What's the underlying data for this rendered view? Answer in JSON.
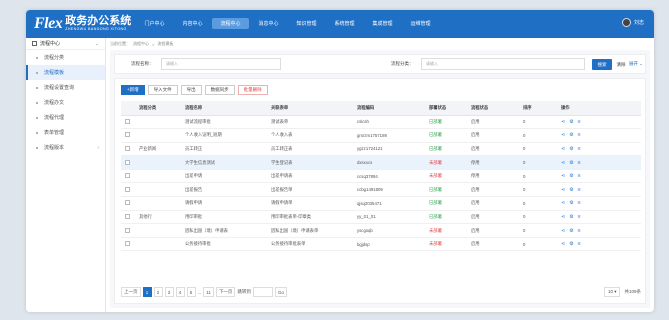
{
  "app": {
    "logo_mark": "Flex",
    "logo_cn": "政务办公系统",
    "logo_en": "ZHENGWU BANGONG XITONG"
  },
  "nav": [
    "门户中心",
    "内容中心",
    "流程中心",
    "消息中心",
    "知识管理",
    "系统管理",
    "集成管理",
    "运维管理"
  ],
  "user": {
    "name": "刘志"
  },
  "sidebar": {
    "header": "流程中心",
    "items": [
      {
        "label": "流程分类"
      },
      {
        "label": "流程模板"
      },
      {
        "label": "流程设置查询"
      },
      {
        "label": "流程办文"
      },
      {
        "label": "流程代理"
      },
      {
        "label": "表单管理"
      },
      {
        "label": "流程版本"
      }
    ]
  },
  "breadcrumb": [
    "当前位置：",
    "流程中心",
    "流程模板"
  ],
  "search": {
    "name_label": "流程名称：",
    "name_placeholder": "请输入",
    "cat_label": "流程分类：",
    "cat_placeholder": "请输入",
    "search_btn": "搜索",
    "clear_btn": "清除",
    "expand_btn": "展开 ⌄"
  },
  "toolbar": {
    "add": "+新增",
    "import": "导入文件",
    "export": "导出",
    "sync": "数据同步",
    "batch_delete": "批量删除"
  },
  "table": {
    "headers": [
      "流程分类",
      "流程名称",
      "关联表单",
      "流程编码",
      "部署状态",
      "流程状态",
      "排序",
      "操作"
    ],
    "rows": [
      {
        "cat": "",
        "name": "测试流程审批",
        "form": "测试表单",
        "code": "cslcsh",
        "deploy": "已部署",
        "dclass": "st-ok",
        "status": "启用",
        "sort": "0"
      },
      {
        "cat": "",
        "name": "个人收入证明_短期",
        "form": "个人收入表",
        "code": "grsrzm1757189",
        "deploy": "已部署",
        "dclass": "st-ok",
        "status": "启用",
        "sort": "0"
      },
      {
        "cat": "产业新闻",
        "name": "员工转正",
        "form": "员工转正表",
        "code": "ygzz1724121",
        "deploy": "已部署",
        "dclass": "st-ok",
        "status": "启用",
        "sort": "0"
      },
      {
        "cat": "",
        "name": "大学生信息测试",
        "form": "学生登记表",
        "code": "dxsxxcs",
        "deploy": "未部署",
        "dclass": "st-no",
        "status": "停用",
        "sort": "0",
        "hl": true
      },
      {
        "cat": "",
        "name": "出差申请",
        "form": "出差申请表",
        "code": "ccsq37894",
        "deploy": "未部署",
        "dclass": "st-no",
        "status": "停用",
        "sort": "0"
      },
      {
        "cat": "",
        "name": "出差报告",
        "form": "出差报告单",
        "code": "ccbg1491809",
        "deploy": "已部署",
        "dclass": "st-ok",
        "status": "启用",
        "sort": "0"
      },
      {
        "cat": "",
        "name": "请假申请",
        "form": "请假申请单",
        "code": "qjsq2035471",
        "deploy": "已部署",
        "dclass": "st-ok",
        "status": "启用",
        "sort": "0"
      },
      {
        "cat": "其他行",
        "name": "用印审批",
        "form": "用印审批表单-印章类",
        "code": "yy_01_01",
        "deploy": "已部署",
        "dclass": "st-ok",
        "status": "启用",
        "sort": "0"
      },
      {
        "cat": "",
        "name": "因私出国（境）申请表",
        "form": "因私出国（境）申请表单",
        "code": "yscgsqb",
        "deploy": "未部署",
        "dclass": "st-no",
        "status": "启用",
        "sort": "0"
      },
      {
        "cat": "",
        "name": "公务接待审批",
        "form": "公务接待审批表单",
        "code": "bgjdsp",
        "deploy": "未部署",
        "dclass": "st-no",
        "status": "启用",
        "sort": "0"
      }
    ]
  },
  "pager": {
    "prev": "上一页",
    "pages": [
      "1",
      "2",
      "3",
      "4",
      "5"
    ],
    "ellipsis": "...",
    "last": "11",
    "next": "下一页",
    "goto_label": "跳转到",
    "go": "Go",
    "size": "10 ▾",
    "total": "共109条"
  }
}
